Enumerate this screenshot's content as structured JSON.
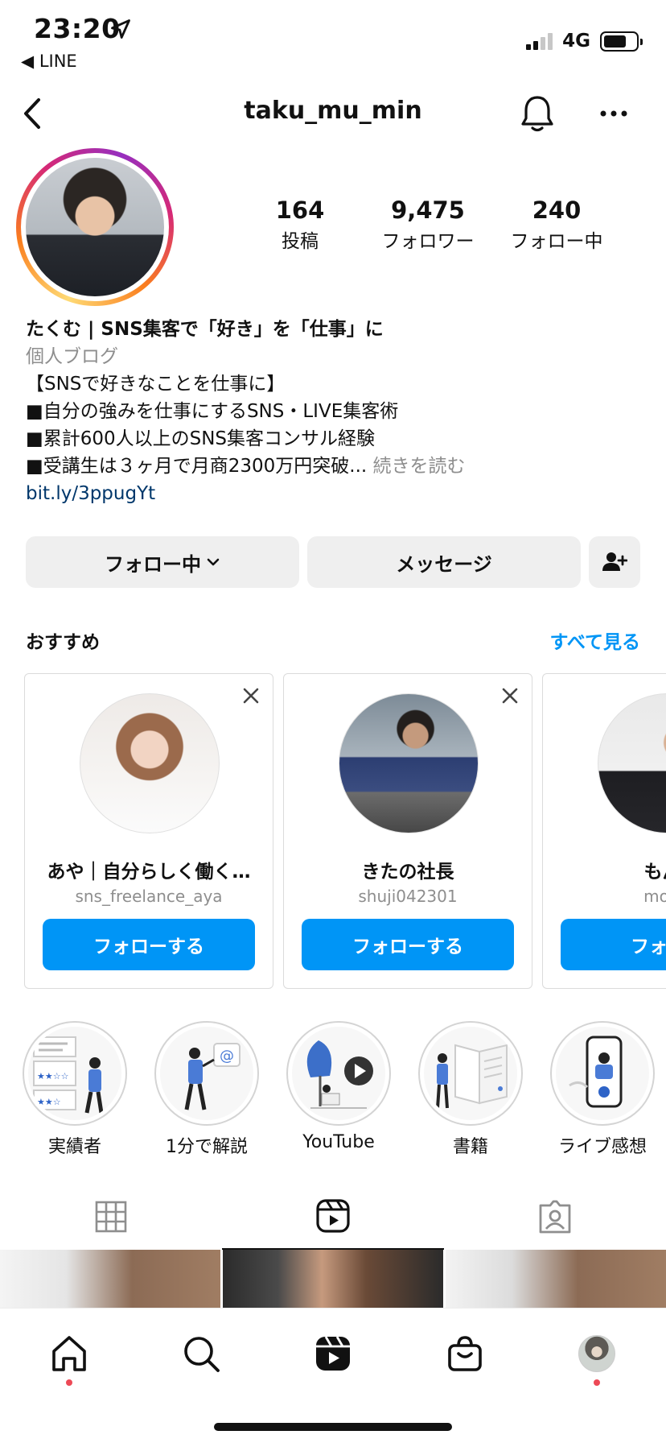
{
  "status_bar": {
    "time": "23:20",
    "back_app": "◀ LINE",
    "network": "4G",
    "battery_fraction": 0.72
  },
  "header": {
    "username": "taku_mu_min"
  },
  "stats": [
    {
      "value": "164",
      "label": "投稿"
    },
    {
      "value": "9,475",
      "label": "フォロワー"
    },
    {
      "value": "240",
      "label": "フォロー中"
    }
  ],
  "bio": {
    "display_name": "たくむ | SNS集客で「好き」を「仕事」に",
    "category": "個人ブログ",
    "lines": [
      "【SNSで好きなことを仕事に】",
      "■自分の強みを仕事にするSNS・LIVE集客術",
      "■累計600人以上のSNS集客コンサル経験"
    ],
    "last_line": "■受講生は３ヶ月で月商2300万円突破...",
    "read_more": "続きを読む",
    "link": "bit.ly/3ppugYt"
  },
  "actions": {
    "following": "フォロー中",
    "message": "メッセージ"
  },
  "suggestions": {
    "title": "おすすめ",
    "see_all": "すべて見る",
    "cards": [
      {
        "name": "あや｜自分らしく働く…",
        "username": "sns_freelance_aya",
        "button": "フォローする"
      },
      {
        "name": "きたの社長",
        "username": "shuji042301",
        "button": "フォローする"
      },
      {
        "name": "もんぐ",
        "username": "mongu",
        "button": "フォロー"
      }
    ]
  },
  "highlights": [
    {
      "label": "実績者"
    },
    {
      "label": "1分で解説"
    },
    {
      "label": "YouTube"
    },
    {
      "label": "書籍"
    },
    {
      "label": "ライブ感想"
    }
  ],
  "colors": {
    "accent": "#0095f6",
    "link": "#00376b",
    "muted": "#8e8e8e",
    "notification": "#ed4956"
  }
}
